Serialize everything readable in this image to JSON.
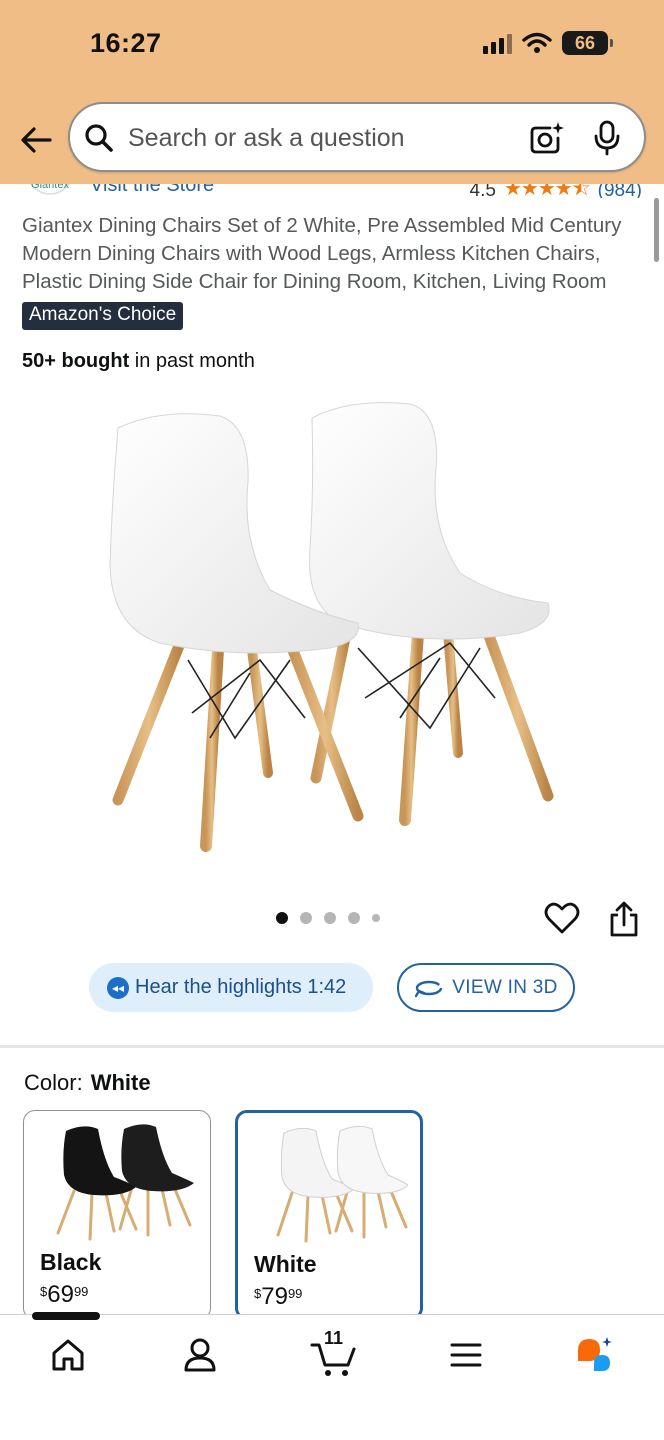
{
  "status_bar": {
    "time": "16:27",
    "battery": "66"
  },
  "search": {
    "placeholder": "Search or ask a question"
  },
  "store": {
    "logo_text": "Giantex",
    "link": "Visit the Store",
    "rating": "4.5",
    "stars": "★★★★⯪",
    "review_count": "(984)"
  },
  "product": {
    "title": "Giantex Dining Chairs Set of 2 White, Pre Assembled Mid Century Modern Dining Chairs with Wood Legs, Armless Kitchen Chairs, Plastic Dining Side Chair for Dining Room, Kitchen, Living Room",
    "badge": "Amazon's Choice",
    "bought_bold": "50+ bought",
    "bought_rest": " in past month"
  },
  "carousel": {
    "total": 5,
    "active": 1
  },
  "actions": {
    "hear_label": "Hear the highlights 1:42",
    "view3d_label": "VIEW IN 3D"
  },
  "color": {
    "label": "Color:",
    "selected": "White",
    "options": [
      {
        "name": "Black",
        "symbol": "$",
        "dollars": "69",
        "cents": "99"
      },
      {
        "name": "White",
        "symbol": "$",
        "dollars": "79",
        "cents": "99"
      }
    ]
  },
  "nav": {
    "cart_count": "11"
  },
  "colors": {
    "header_bg": "#f0bd86",
    "link_blue": "#2162a1",
    "star_orange": "#ee7a12",
    "badge_bg": "#232f3e",
    "rufus_orange": "#f66a0a",
    "rufus_blue": "#1a9cf0"
  }
}
